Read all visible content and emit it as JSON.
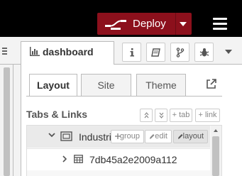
{
  "header": {
    "deploy_label": "Deploy",
    "deploy_icon": "deploy-flow-icon",
    "deploy_color": "#8c101c",
    "menu_icon": "hamburger-menu-icon"
  },
  "sidebar": {
    "active_tab": {
      "label": "dashboard",
      "icon": "bar-chart-icon"
    },
    "tab_buttons": [
      "info-icon",
      "book-icon",
      "git-branch-icon",
      "bug-icon"
    ]
  },
  "dashboard": {
    "tabs": [
      {
        "label": "Layout",
        "active": true
      },
      {
        "label": "Site",
        "active": false
      },
      {
        "label": "Theme",
        "active": false
      }
    ],
    "section_title": "Tabs & Links",
    "actions": {
      "add_tab": "+ tab",
      "add_link": "+ link"
    },
    "tree": {
      "group_row": {
        "label": "Industrial",
        "buttons": {
          "group": "group",
          "edit": "edit",
          "layout": "layout"
        }
      },
      "tab_row": {
        "label": "7db45a2e2009a112"
      }
    }
  }
}
